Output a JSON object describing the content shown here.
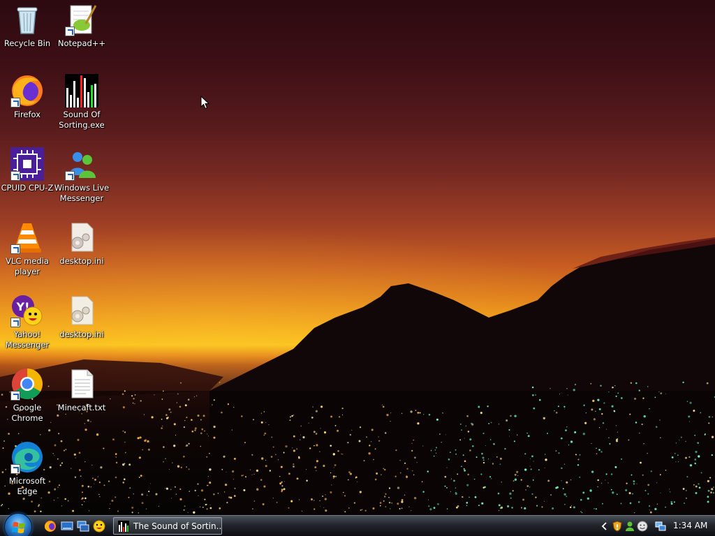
{
  "desktop": {
    "icons": [
      {
        "name": "recycle-bin",
        "label": "Recycle Bin"
      },
      {
        "name": "notepad-plus-plus",
        "label": "Notepad++"
      },
      {
        "name": "firefox",
        "label": "Firefox"
      },
      {
        "name": "sound-of-sorting",
        "label": "Sound Of Sorting.exe"
      },
      {
        "name": "cpuid-cpu-z",
        "label": "CPUID CPU-Z"
      },
      {
        "name": "windows-live-messenger",
        "label": "Windows Live Messenger"
      },
      {
        "name": "vlc-media-player",
        "label": "VLC media player"
      },
      {
        "name": "desktop-ini-1",
        "label": "desktop.ini"
      },
      {
        "name": "yahoo-messenger",
        "label": "Yahoo! Messenger"
      },
      {
        "name": "desktop-ini-2",
        "label": "desktop.ini"
      },
      {
        "name": "google-chrome",
        "label": "Google Chrome"
      },
      {
        "name": "minecaft-txt",
        "label": "Minecaft.txt"
      },
      {
        "name": "microsoft-edge",
        "label": "Microsoft Edge"
      }
    ]
  },
  "taskbar": {
    "task_title": "The Sound of Sortin...",
    "clock": "1:34 AM",
    "quick_launch": [
      "firefox-icon",
      "show-desktop-icon",
      "switch-windows-icon",
      "yahoo-messenger-icon"
    ],
    "tray_icons": [
      "chevron-left-icon",
      "security-shield-icon",
      "messenger-status-icon",
      "yahoo-tray-icon",
      "network-icon"
    ]
  },
  "colors": {
    "sky_top": "#2c0a10",
    "horizon": "#f9c119",
    "city_lights": "#7affc8",
    "taskbar": "#22262c"
  }
}
